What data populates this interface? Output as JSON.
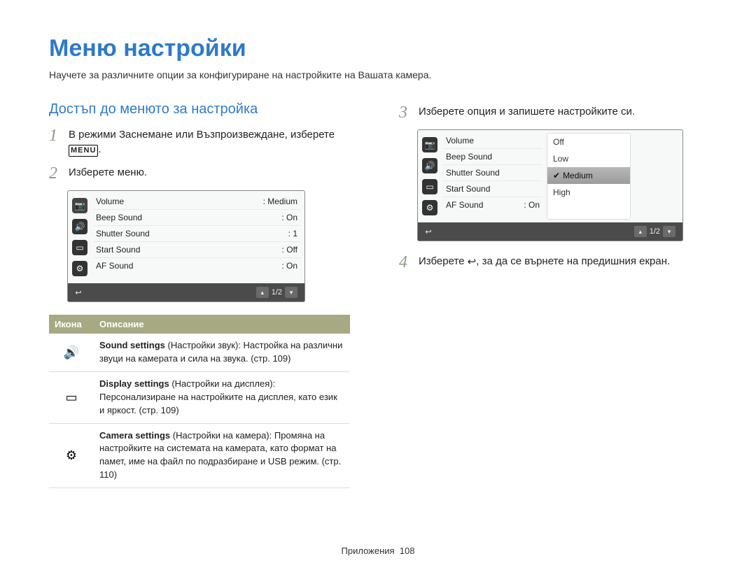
{
  "title": "Меню настройки",
  "subtitle": "Научете за различните опции за конфигуриране на настройките на Вашата камера.",
  "section_heading": "Достъп до менюто за настройка",
  "steps": {
    "s1_num": "1",
    "s1_a": "В режими Заснемане или Възпроизвеждане, изберете ",
    "s1_b": ".",
    "menu_label": "MENU",
    "s2_num": "2",
    "s2": "Изберете меню.",
    "s3_num": "3",
    "s3": "Изберете опция и запишете настройките си.",
    "s4_num": "4",
    "s4_a": "Изберете ",
    "s4_b": ", за да се върнете на предишния екран."
  },
  "menu1": {
    "rows": [
      {
        "label": "Volume",
        "value": ": Medium"
      },
      {
        "label": "Beep Sound",
        "value": ": On"
      },
      {
        "label": "Shutter Sound",
        "value": ": 1"
      },
      {
        "label": "Start Sound",
        "value": ": Off"
      },
      {
        "label": "AF Sound",
        "value": ": On"
      }
    ],
    "page": "1/2"
  },
  "menu2": {
    "rows": [
      {
        "label": "Volume"
      },
      {
        "label": "Beep Sound"
      },
      {
        "label": "Shutter Sound"
      },
      {
        "label": "Start Sound"
      },
      {
        "label": "AF Sound",
        "value": ": On"
      }
    ],
    "options": [
      "Off",
      "Low",
      "Medium",
      "High"
    ],
    "selected": "Medium",
    "page": "1/2"
  },
  "table": {
    "h1": "Икона",
    "h2": "Описание",
    "r1_bold": "Sound settings",
    "r1_rest": " (Настройки звук): Настройка на различни звуци на камерата и сила на звука. (стр. 109)",
    "r2_bold": "Display settings",
    "r2_rest": " (Настройки на дисплея): Персонализиране на настройките на дисплея, като език и яркост. (стр. 109)",
    "r3_bold": "Camera settings",
    "r3_rest": " (Настройки на камера): Промяна на настройките на системата на камерата, като формат на памет, име на файл по подразбиране и USB режим. (стр. 110)"
  },
  "footer_label": "Приложения",
  "footer_page": "108"
}
